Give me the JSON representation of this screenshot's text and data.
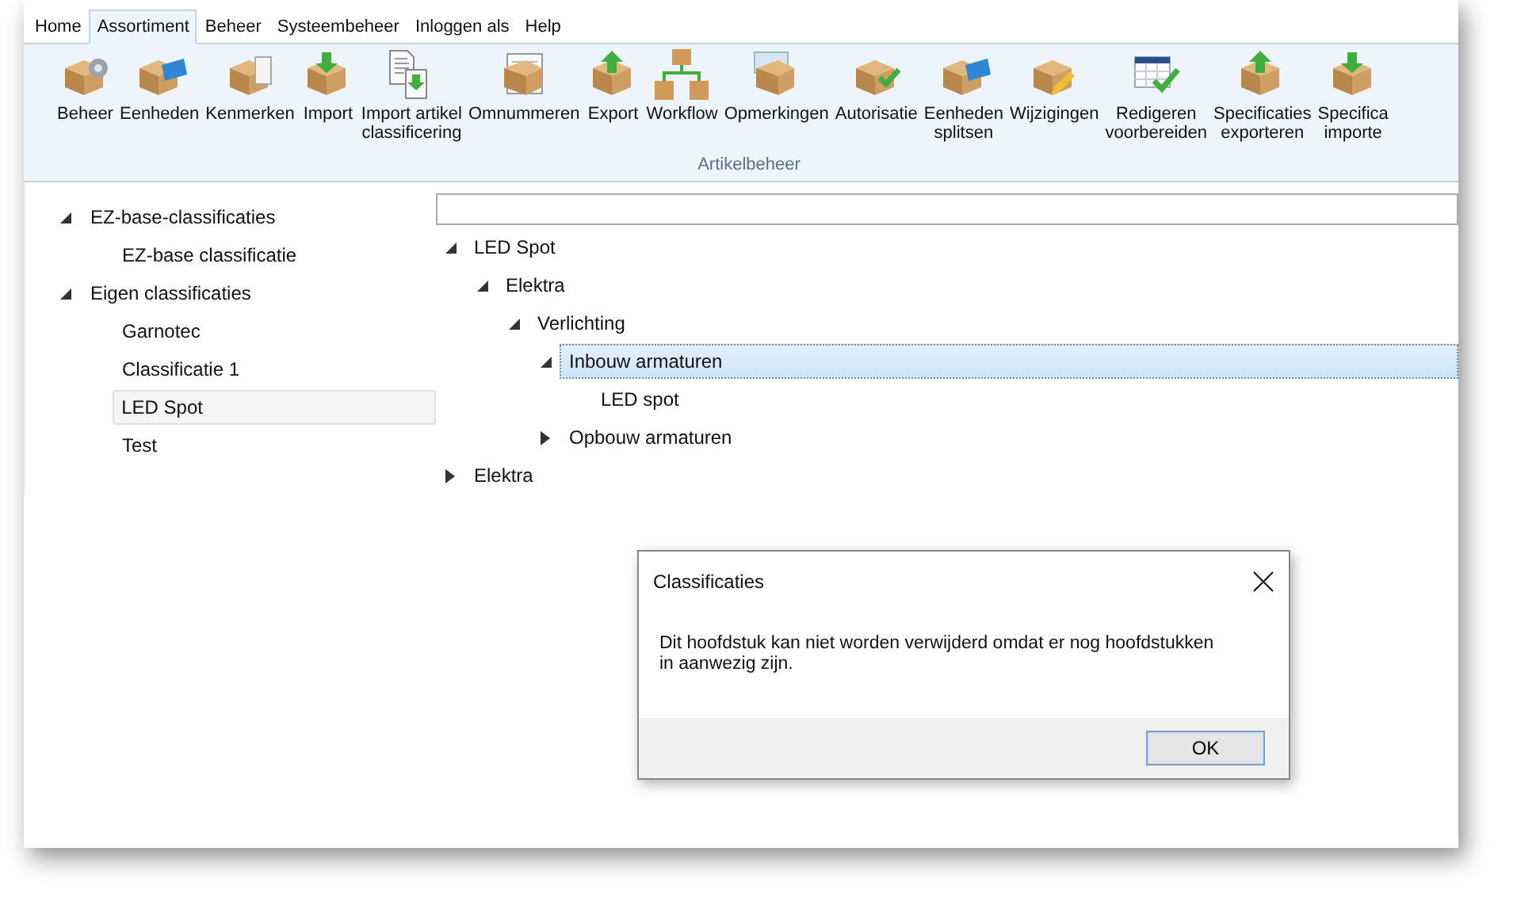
{
  "menu": [
    {
      "label": "Home",
      "selected": false
    },
    {
      "label": "Assortiment",
      "selected": true
    },
    {
      "label": "Beheer",
      "selected": false
    },
    {
      "label": "Systeembeheer",
      "selected": false
    },
    {
      "label": "Inloggen als",
      "selected": false
    },
    {
      "label": "Help",
      "selected": false
    }
  ],
  "ribbon": {
    "group": "Artikelbeheer",
    "items": [
      {
        "label": "Beheer"
      },
      {
        "label": "Eenheden"
      },
      {
        "label": "Kenmerken"
      },
      {
        "label": "Import"
      },
      {
        "label": "Import artikel\nclassificering"
      },
      {
        "label": "Omnummeren"
      },
      {
        "label": "Export"
      },
      {
        "label": "Workflow"
      },
      {
        "label": "Opmerkingen"
      },
      {
        "label": "Autorisatie"
      },
      {
        "label": "Eenheden\nsplitsen"
      },
      {
        "label": "Wijzigingen"
      },
      {
        "label": "Redigeren\nvoorbereiden"
      },
      {
        "label": "Specificaties\nexporteren"
      },
      {
        "label": "Specifica\nimporte"
      }
    ]
  },
  "sidebar": {
    "tree": [
      {
        "label": "EZ-base-classificaties",
        "expanded": true,
        "selected": false,
        "children": [
          {
            "label": "EZ-base classificatie",
            "selected": false
          }
        ]
      },
      {
        "label": "Eigen classificaties",
        "expanded": true,
        "selected": false,
        "children": [
          {
            "label": "Garnotec",
            "selected": false
          },
          {
            "label": "Classificatie 1",
            "selected": false
          },
          {
            "label": "LED Spot",
            "selected": true
          },
          {
            "label": "Test",
            "selected": false
          }
        ]
      }
    ]
  },
  "content": {
    "tree": [
      {
        "label": "LED Spot",
        "expanded": true,
        "selected": false,
        "children": [
          {
            "label": "Elektra",
            "expanded": true,
            "selected": false,
            "children": [
              {
                "label": "Verlichting",
                "expanded": true,
                "selected": false,
                "children": [
                  {
                    "label": "Inbouw armaturen",
                    "expanded": true,
                    "selected": true,
                    "children": [
                      {
                        "label": "LED spot",
                        "selected": false
                      }
                    ]
                  },
                  {
                    "label": "Opbouw armaturen",
                    "expanded": false,
                    "selected": false
                  }
                ]
              }
            ]
          }
        ]
      },
      {
        "label": "Elektra",
        "expanded": false,
        "selected": false
      }
    ]
  },
  "dialog": {
    "title": "Classificaties",
    "message": "Dit hoofdstuk kan niet worden verwijderd omdat er nog hoofdstukken in aanwezig zijn.",
    "buttons": [
      "OK"
    ]
  }
}
